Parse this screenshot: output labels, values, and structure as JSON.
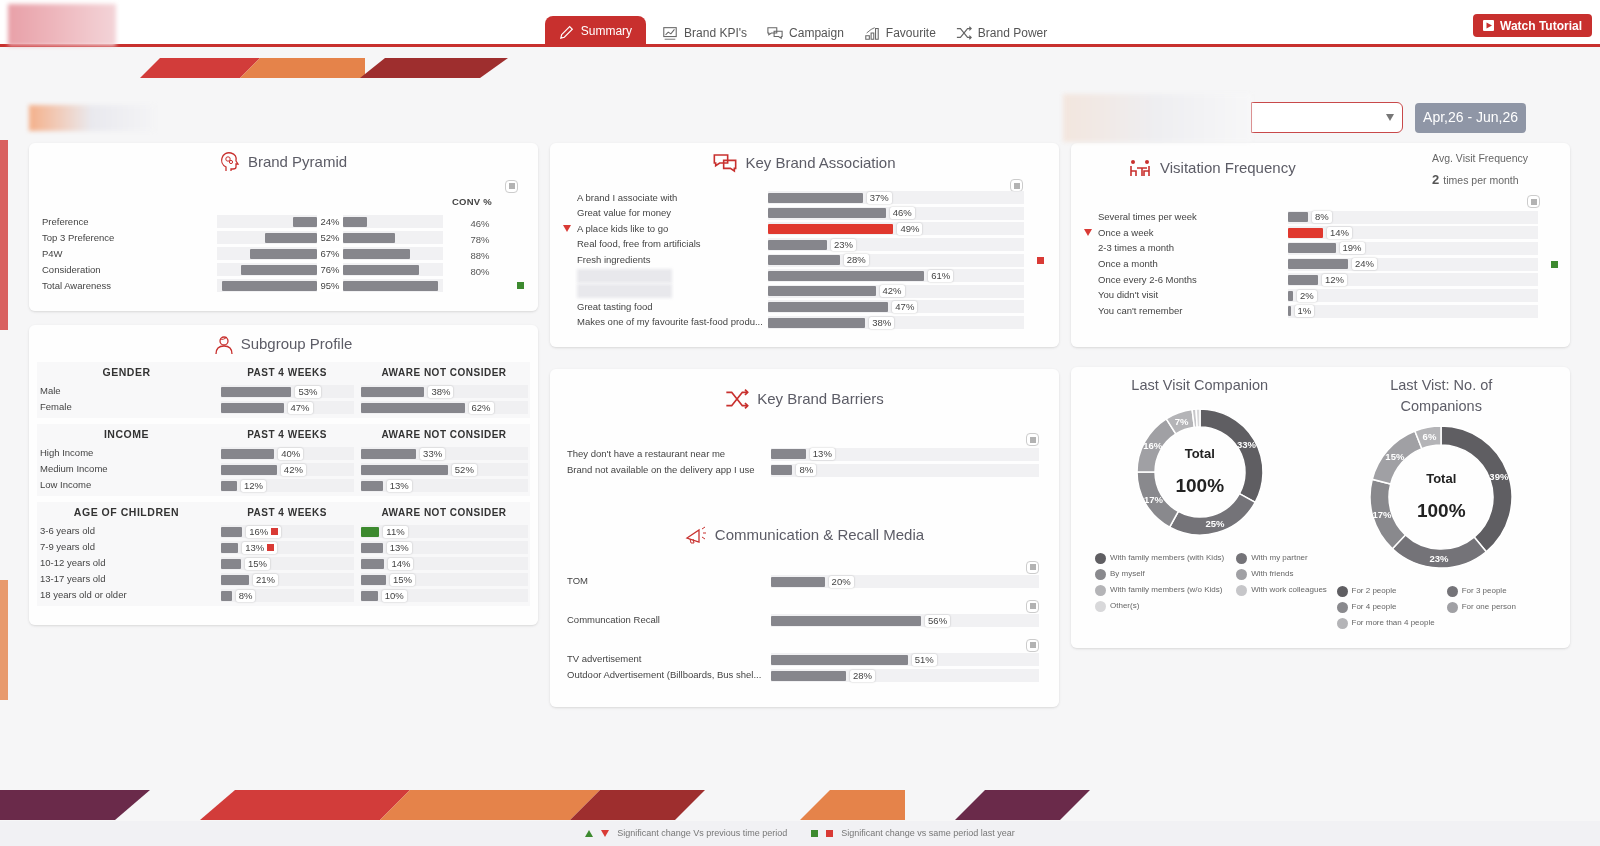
{
  "header": {
    "tabs": [
      {
        "label": "Summary",
        "selected": true
      },
      {
        "label": "Brand KPI's",
        "selected": false
      },
      {
        "label": "Campaign",
        "selected": false
      },
      {
        "label": "Favourite",
        "selected": false
      },
      {
        "label": "Brand Power",
        "selected": false
      }
    ],
    "tutorial_button": "Watch Tutorial"
  },
  "filters": {
    "date_range": "Apr,26 - Jun,26"
  },
  "brand_pyramid": {
    "title": "Brand Pyramid",
    "conv_header": "CONV %",
    "rows": [
      {
        "label": "Preference",
        "value": "24%",
        "level": 0.24,
        "conv": "46%",
        "up_vs_last_year": false
      },
      {
        "label": "Top 3 Preference",
        "value": "52%",
        "level": 0.52,
        "conv": "78%",
        "up_vs_last_year": false
      },
      {
        "label": "P4W",
        "value": "67%",
        "level": 0.67,
        "conv": "88%",
        "up_vs_last_year": false
      },
      {
        "label": "Consideration",
        "value": "76%",
        "level": 0.76,
        "conv": "80%",
        "up_vs_last_year": false
      },
      {
        "label": "Total Awareness",
        "value": "95%",
        "level": 0.95,
        "up_vs_last_year": true
      }
    ]
  },
  "subgroup_profile": {
    "title": "Subgroup Profile",
    "sections": [
      {
        "heading": "GENDER",
        "col_1": "PAST 4 WEEKS",
        "col_2": "AWARE NOT CONSIDER",
        "rows": [
          {
            "label": "Male",
            "past": {
              "value": "53%",
              "level": 0.53,
              "down_vs_last_year": false
            },
            "aware": {
              "value": "38%",
              "level": 0.38,
              "up_vs_previous": false
            }
          },
          {
            "label": "Female",
            "past": {
              "value": "47%",
              "level": 0.47,
              "down_vs_last_year": false
            },
            "aware": {
              "value": "62%",
              "level": 0.62,
              "up_vs_previous": false
            }
          }
        ]
      },
      {
        "heading": "INCOME",
        "col_1": "PAST 4 WEEKS",
        "col_2": "AWARE NOT CONSIDER",
        "rows": [
          {
            "label": "High Income",
            "past": {
              "value": "40%",
              "level": 0.4,
              "down_vs_last_year": false
            },
            "aware": {
              "value": "33%",
              "level": 0.33,
              "up_vs_previous": false
            }
          },
          {
            "label": "Medium Income",
            "past": {
              "value": "42%",
              "level": 0.42,
              "down_vs_last_year": false
            },
            "aware": {
              "value": "52%",
              "level": 0.52,
              "up_vs_previous": false
            }
          },
          {
            "label": "Low Income",
            "past": {
              "value": "12%",
              "level": 0.12,
              "down_vs_last_year": false
            },
            "aware": {
              "value": "13%",
              "level": 0.13,
              "up_vs_previous": false
            }
          }
        ]
      },
      {
        "heading": "AGE OF CHILDREN",
        "col_1": "PAST 4 WEEKS",
        "col_2": "AWARE NOT CONSIDER",
        "rows": [
          {
            "label": "3-6 years old",
            "past": {
              "value": "16%",
              "level": 0.16,
              "down_vs_last_year": true
            },
            "aware": {
              "value": "11%",
              "level": 0.11,
              "up_vs_previous": true
            }
          },
          {
            "label": "7-9 years old",
            "past": {
              "value": "13%",
              "level": 0.13,
              "down_vs_last_year": true
            },
            "aware": {
              "value": "13%",
              "level": 0.13,
              "up_vs_previous": false
            }
          },
          {
            "label": "10-12 years old",
            "past": {
              "value": "15%",
              "level": 0.15,
              "down_vs_last_year": false
            },
            "aware": {
              "value": "14%",
              "level": 0.14,
              "up_vs_previous": false
            }
          },
          {
            "label": "13-17 years old",
            "past": {
              "value": "21%",
              "level": 0.21,
              "down_vs_last_year": false
            },
            "aware": {
              "value": "15%",
              "level": 0.15,
              "up_vs_previous": false
            }
          },
          {
            "label": "18 years old or older",
            "past": {
              "value": "8%",
              "level": 0.08,
              "down_vs_last_year": false
            },
            "aware": {
              "value": "10%",
              "level": 0.1,
              "up_vs_previous": false
            }
          }
        ]
      }
    ]
  },
  "key_brand_association": {
    "title": "Key Brand Association",
    "rows": [
      {
        "label": "A brand I associate with",
        "value": "37%",
        "level": 0.37,
        "down_vs_previous": false,
        "down_vs_last_year": false
      },
      {
        "label": "Great value for money",
        "value": "46%",
        "level": 0.46,
        "down_vs_previous": false,
        "down_vs_last_year": false
      },
      {
        "label": "A place kids like to go",
        "value": "49%",
        "level": 0.49,
        "down_vs_previous": true,
        "down_vs_last_year": false
      },
      {
        "label": "Real food, free from artificials",
        "value": "23%",
        "level": 0.23,
        "down_vs_previous": false,
        "down_vs_last_year": false
      },
      {
        "label": "Fresh ingredients",
        "value": "28%",
        "level": 0.28,
        "down_vs_previous": false,
        "down_vs_last_year": true
      },
      {
        "value": "61%",
        "level": 0.61,
        "down_vs_previous": false,
        "down_vs_last_year": false
      },
      {
        "value": "42%",
        "level": 0.42,
        "down_vs_previous": false,
        "down_vs_last_year": false
      },
      {
        "label": "Great tasting food",
        "value": "47%",
        "level": 0.47,
        "down_vs_previous": false,
        "down_vs_last_year": false
      },
      {
        "label": "Makes one of my favourite fast-food produ...",
        "value": "38%",
        "level": 0.38,
        "down_vs_previous": false,
        "down_vs_last_year": false
      }
    ]
  },
  "key_brand_barriers": {
    "title": "Key Brand Barriers",
    "rows": [
      {
        "label": "They don't have a restaurant near me",
        "value": "13%",
        "level": 0.13
      },
      {
        "label": "Brand not available on the delivery app I use",
        "value": "8%",
        "level": 0.08
      }
    ]
  },
  "communication_recall_media": {
    "title": "Communication & Recall Media",
    "groups": [
      [
        {
          "label": "TOM",
          "value": "20%",
          "level": 0.2
        }
      ],
      [
        {
          "label": "Communcation Recall",
          "value": "56%",
          "level": 0.56
        }
      ],
      [
        {
          "label": "TV advertisement",
          "value": "51%",
          "level": 0.51
        },
        {
          "label": "Outdoor Advertisement (Billboards, Bus shel...",
          "value": "28%",
          "level": 0.28
        }
      ]
    ]
  },
  "visitation_frequency": {
    "title": "Visitation Frequency",
    "avg_label": "Avg. Visit Frequency",
    "avg_value": "2",
    "avg_unit": "times per month",
    "rows": [
      {
        "label": "Several times per week",
        "value": "8%",
        "level": 0.08,
        "down_vs_previous": false,
        "up_vs_last_year": false
      },
      {
        "label": "Once a week",
        "value": "14%",
        "level": 0.14,
        "down_vs_previous": true,
        "up_vs_last_year": false
      },
      {
        "label": "2-3 times a month",
        "value": "19%",
        "level": 0.19,
        "down_vs_previous": false,
        "up_vs_last_year": false
      },
      {
        "label": "Once a month",
        "value": "24%",
        "level": 0.24,
        "down_vs_previous": false,
        "up_vs_last_year": true
      },
      {
        "label": "Once every 2-6 Months",
        "value": "12%",
        "level": 0.12,
        "down_vs_previous": false,
        "up_vs_last_year": false
      },
      {
        "label": "You didn't visit",
        "value": "2%",
        "level": 0.02,
        "down_vs_previous": false,
        "up_vs_last_year": false
      },
      {
        "label": "You can't remember",
        "value": "1%",
        "level": 0.01,
        "down_vs_previous": false,
        "up_vs_last_year": false
      }
    ]
  },
  "last_visit_companion": {
    "title": "Last Visit Companion",
    "center_label": "Total",
    "center_value": "100%",
    "chart_data": {
      "type": "donut",
      "categories": [
        "With family members (with Kids)",
        "With my partner",
        "By myself",
        "With friends",
        "With family members (w/o Kids)",
        "With work colleagues",
        "Other(s)"
      ],
      "values": [
        33,
        25,
        17,
        16,
        7,
        1,
        1
      ],
      "value_labels": [
        "33%",
        "25%",
        "17%",
        "16%",
        "7%",
        null,
        null
      ]
    }
  },
  "last_visit_companions_count": {
    "title": "Last Vist: No. of Companions",
    "center_label": "Total",
    "center_value": "100%",
    "chart_data": {
      "type": "donut",
      "categories": [
        "For 2 people",
        "For 3 people",
        "For 4 people",
        "For one person",
        "For more than 4 people"
      ],
      "values": [
        39,
        23,
        17,
        15,
        6
      ],
      "value_labels": [
        "39%",
        "23%",
        "17%",
        "15%",
        "6%"
      ]
    }
  },
  "footer_legend": [
    {
      "kind": "triangles",
      "label": "Significant change Vs previous time period"
    },
    {
      "kind": "squares",
      "label": "Significant change vs same period last year"
    }
  ]
}
